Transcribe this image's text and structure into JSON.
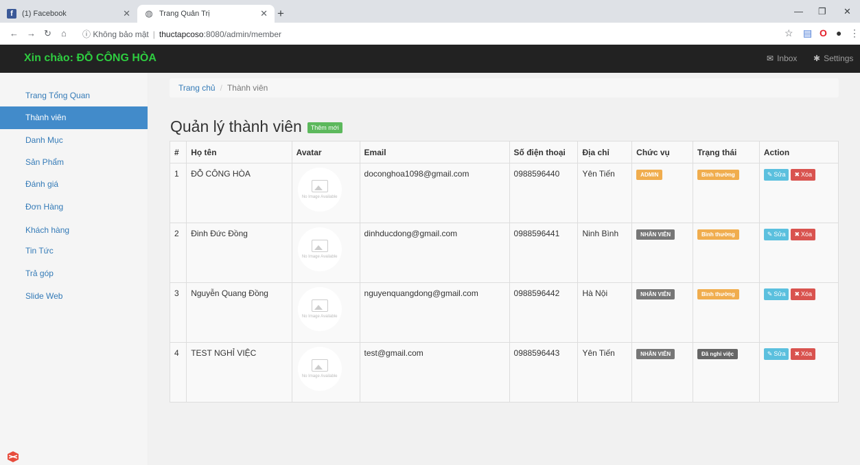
{
  "browser": {
    "tabs": [
      {
        "title": "(1) Facebook",
        "icon": "facebook-icon"
      },
      {
        "title": "Trang Quản Trị",
        "icon": "globe-icon"
      }
    ],
    "security_text": "Không bảo mật",
    "url_host": "thuctapcoso",
    "url_rest": ":8080/admin/member"
  },
  "header": {
    "greeting": "Xin chào: ĐỖ CÔNG HÒA",
    "inbox": "Inbox",
    "settings": "Settings"
  },
  "sidebar": {
    "items": [
      {
        "label": "Trang Tổng Quan",
        "active": false
      },
      {
        "label": "Thành viên",
        "active": true
      },
      {
        "label": "Danh Mục",
        "active": false
      },
      {
        "label": "Sản Phẩm",
        "active": false
      },
      {
        "label": "Đánh giá",
        "active": false
      },
      {
        "label": "Đơn Hàng",
        "active": false
      },
      {
        "label": "Khách hàng",
        "active": false
      },
      {
        "label": "Tin Tức",
        "active": false
      },
      {
        "label": "Trả góp",
        "active": false
      },
      {
        "label": "Slide Web",
        "active": false
      }
    ]
  },
  "breadcrumb": {
    "home": "Trang chủ",
    "current": "Thành viên"
  },
  "page": {
    "title": "Quản lý thành viên",
    "add_label": "Thêm mới"
  },
  "table": {
    "headers": [
      "#",
      "Họ tên",
      "Avatar",
      "Email",
      "Số điện thoại",
      "Địa chỉ",
      "Chức vụ",
      "Trạng thái",
      "Action"
    ],
    "avatar_placeholder": "No Image Available",
    "edit_label": "Sửa",
    "delete_label": "Xóa",
    "rows": [
      {
        "id": "1",
        "name": "ĐỖ CÔNG HÒA",
        "email": "doconghoa1098@gmail.com",
        "phone": "0988596440",
        "address": "Yên Tiến",
        "role": "ADMIN",
        "status": "Bình thường"
      },
      {
        "id": "2",
        "name": "Đinh Đức Đồng",
        "email": "dinhducdong@gmail.com",
        "phone": "0988596441",
        "address": "Ninh Bình",
        "role": "NHÂN VIÊN",
        "status": "Bình thường"
      },
      {
        "id": "3",
        "name": "Nguyễn Quang Đồng",
        "email": "nguyenquangdong@gmail.com",
        "phone": "0988596442",
        "address": "Hà Nội",
        "role": "NHÂN VIÊN",
        "status": "Bình thường"
      },
      {
        "id": "4",
        "name": "TEST NGHỈ VIỆC",
        "email": "test@gmail.com",
        "phone": "0988596443",
        "address": "Yên Tiến",
        "role": "NHÂN VIÊN",
        "status": "Đã nghỉ việc"
      }
    ]
  },
  "colors": {
    "greeting": "#2ecc40",
    "active_sidebar": "#428bca",
    "add_button": "#5cb85c",
    "edit_button": "#5bc0de",
    "delete_button": "#d9534f",
    "admin_label": "#f0ad4e",
    "status_normal": "#f0ad4e"
  }
}
